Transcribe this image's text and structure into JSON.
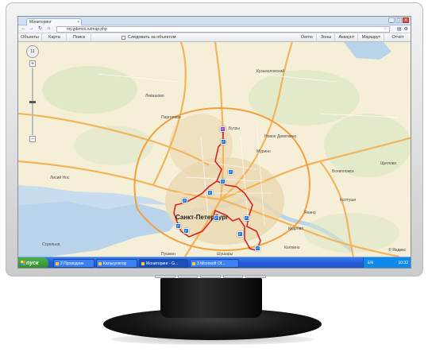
{
  "browser": {
    "tab_title": "Мониторинг",
    "url": "my.gdemoi.ru/map.php",
    "window_controls": [
      "_",
      "□",
      "×"
    ],
    "nav_icons": [
      "back-arrow-icon",
      "forward-arrow-icon",
      "reload-icon",
      "home-icon"
    ],
    "tools_icons": [
      "page-icon",
      "wrench-icon"
    ]
  },
  "toolbar": {
    "objects": "Объекты",
    "map": "Карта",
    "search": "Поиск",
    "follow_label": "Следовать за объектом",
    "demo": "Demo",
    "zones": "Зоны",
    "account": "Аккаунт",
    "route": "Маршрут",
    "report": "Отчёт"
  },
  "map": {
    "zoom_level": "11",
    "city_label": "Санкт-Петербург",
    "places": {
      "kuzmolovsky": "Кузьмоловский",
      "levashovo": "Левашово",
      "pargolovo": "Парголово",
      "yanino": "Янино",
      "vsevolozhsk": "Всеволожск",
      "shchegly": "Щеглово",
      "koltushi": "Колтуши",
      "lisiy_nos": "Лисий Нос",
      "kudrovo": "Кудрово",
      "kolpino": "Колпино",
      "pushkin": "Пушкин",
      "shushary": "Шушары",
      "strelna": "Стрельна",
      "novoe_devyatkino": "Новое Девяткино",
      "murino": "Мурино",
      "bugry": "Бугры"
    },
    "copyright": "© Яндекс"
  },
  "taskbar": {
    "start": "пуск",
    "items": [
      "2 Проводник",
      "Калькулятор",
      "Мониторинг - G...",
      "3 Microsoft Of..."
    ],
    "lang": "EN",
    "clock": "10:32"
  }
}
